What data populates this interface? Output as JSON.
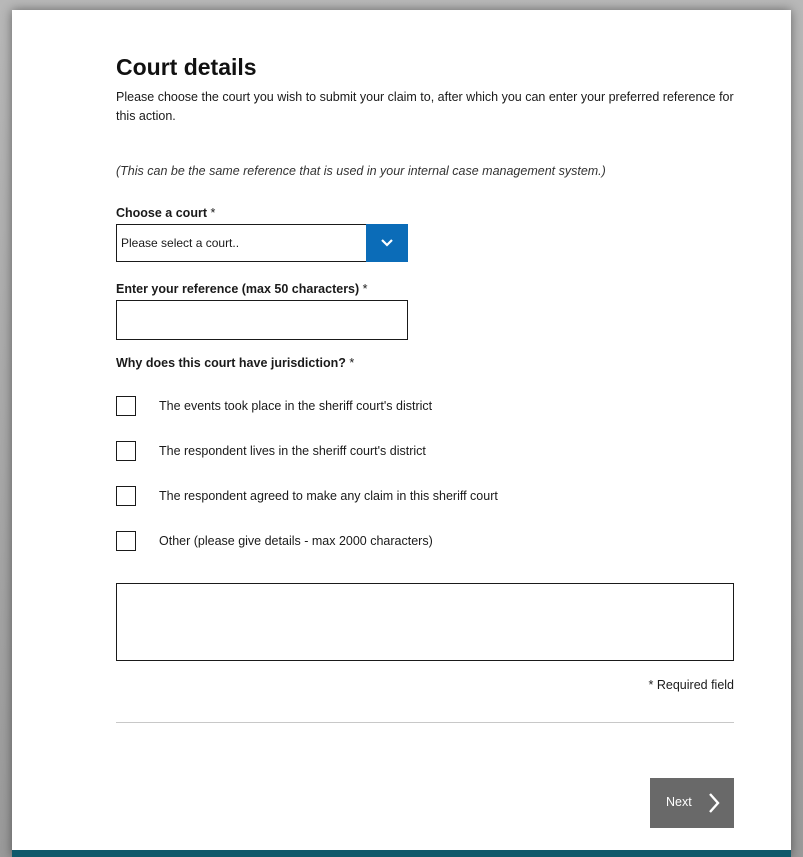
{
  "page": {
    "title": "Court details",
    "intro": "Please choose the court you wish to submit your claim to, after which you can enter your preferred reference for this action.",
    "note": "(This can be the same reference that is used in your internal case management system.)"
  },
  "court_select": {
    "label": "Choose a court",
    "required_mark": " *",
    "value": "Please select a court..",
    "icon": "chevron-down-icon"
  },
  "reference": {
    "label": "Enter your reference (max 50 characters)",
    "required_mark": " *",
    "value": ""
  },
  "jurisdiction": {
    "label": "Why does this court have jurisdiction?",
    "required_mark": " *",
    "options": [
      {
        "label": "The events took place in the sheriff court's district",
        "checked": false
      },
      {
        "label": "The respondent lives in the sheriff court's district",
        "checked": false
      },
      {
        "label": "The respondent agreed to make any claim in this sheriff court",
        "checked": false
      },
      {
        "label": "Other (please give details - max 2000 characters)",
        "checked": false
      }
    ],
    "details_value": ""
  },
  "required_note": "* Required field",
  "actions": {
    "next_label": "Next",
    "next_icon": "chevron-right-icon"
  },
  "colors": {
    "accent": "#0b6cb8",
    "button_bg": "#696969",
    "footer": "#0f5a6b"
  }
}
